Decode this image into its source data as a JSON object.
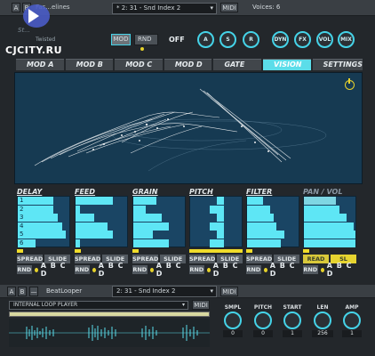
{
  "watermark": "CJCITY.RU",
  "top": {
    "btn_a": "A",
    "btn_b": "B",
    "preset_name": "Fas...elines",
    "snd": "* 2: 31 - Snd Index 2",
    "midi": "MIDI",
    "voices": "Voices: 6",
    "logo": "St...",
    "logo_sub": "Twisted",
    "mod": "MOD",
    "rnd": "RND",
    "off": "OFF",
    "knobs1": [
      "A",
      "S",
      "R"
    ],
    "knobs2": [
      "DYN",
      "FX",
      "VOL",
      "MIX"
    ]
  },
  "tabs": [
    "MOD A",
    "MOD B",
    "MOD C",
    "MOD D",
    "GATE SEQ",
    "VISION",
    "SETTINGS"
  ],
  "sections": [
    {
      "title": "DELAY",
      "rows": [
        "1",
        "2",
        "3",
        "4",
        "5",
        "6"
      ],
      "spread": "SPREAD",
      "slide": "SLIDE",
      "rnd": "RND",
      "abcd": "A B C D"
    },
    {
      "title": "FEED",
      "spread": "SPREAD",
      "slide": "SLIDE",
      "rnd": "RND",
      "abcd": "A B C D"
    },
    {
      "title": "GRAIN",
      "spread": "SPREAD",
      "slide": "SLIDE",
      "rnd": "RND",
      "abcd": "A B C D"
    },
    {
      "title": "PITCH",
      "spread": "SPREAD",
      "slide": "SLIDE",
      "rnd": "RND",
      "abcd": "A B C D"
    },
    {
      "title": "FILTER",
      "spread": "SPREAD",
      "slide": "SLIDE",
      "rnd": "RND",
      "abcd": "A B C D"
    },
    {
      "title": "PAN / VOL",
      "spread": "READ",
      "slide": "SL",
      "rnd": "RND",
      "abcd": "A B C D"
    }
  ],
  "bottom": {
    "btn_a": "A",
    "btn_b": "B",
    "dash": "—",
    "name": "BeatLooper",
    "snd": "2: 31 - Snd Index 2",
    "midi": "MIDI",
    "player": "INTERNAL LOOP PLAYER",
    "player_midi": "MIDI",
    "knobs": [
      {
        "label": "SMPL",
        "value": "0"
      },
      {
        "label": "PITCH",
        "value": "0"
      },
      {
        "label": "START",
        "value": "1"
      },
      {
        "label": "LEN",
        "value": "256"
      },
      {
        "label": "AMP",
        "value": "1"
      }
    ]
  },
  "colors": {
    "accent": "#5ee6f5",
    "yellow": "#f0dc2a",
    "panel": "#163a52"
  }
}
